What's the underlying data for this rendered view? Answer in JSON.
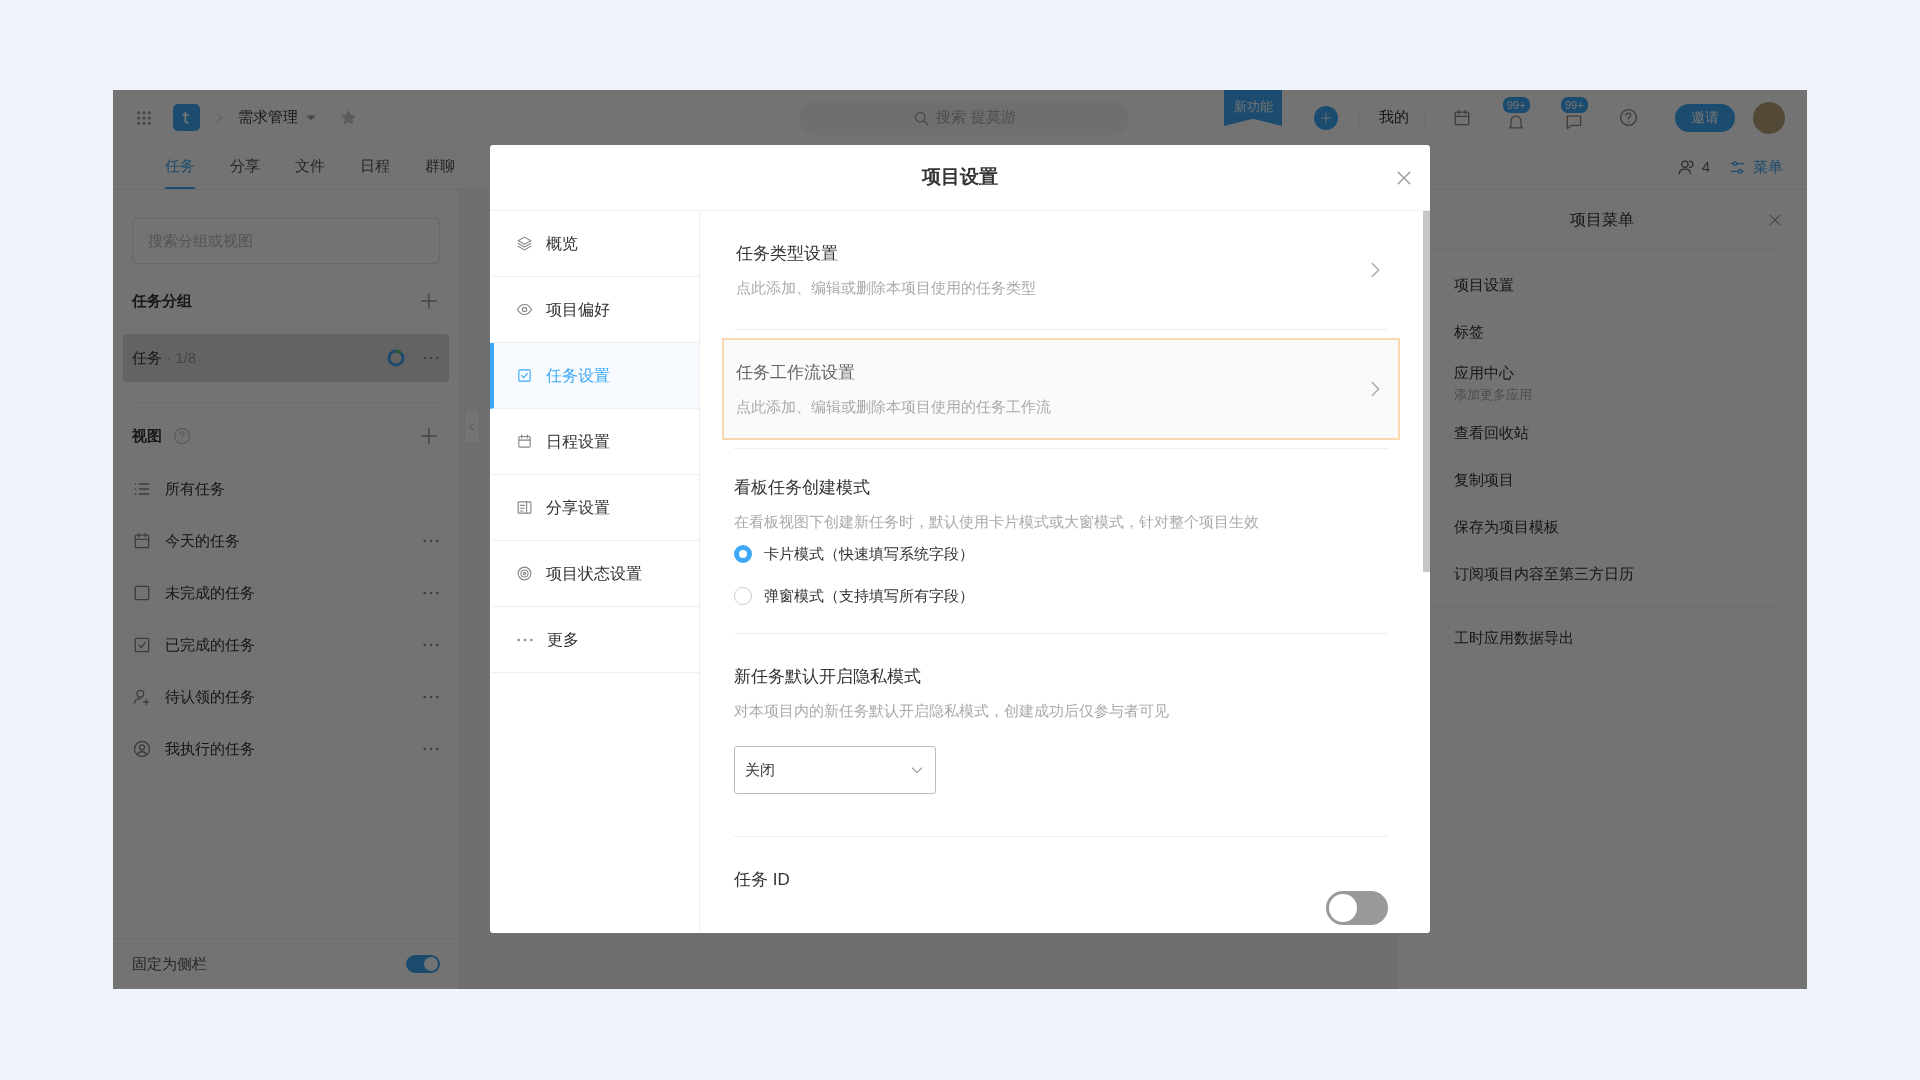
{
  "topbar": {
    "project": "需求管理",
    "search_placeholder": "搜索 提莫游",
    "new_feature_badge": "新功能",
    "mine": "我的",
    "badges": [
      {
        "count": "99+"
      },
      {
        "count": "99+"
      }
    ],
    "invite_button": "邀请"
  },
  "tabs": [
    {
      "label": "任务",
      "selected": true
    },
    {
      "label": "分享",
      "selected": false
    },
    {
      "label": "文件",
      "selected": false
    },
    {
      "label": "日程",
      "selected": false
    },
    {
      "label": "群聊",
      "selected": false
    }
  ],
  "members_count": "4",
  "menu_button": "菜单",
  "sidebar": {
    "search_placeholder": "搜索分组或视图",
    "groups_title": "任务分组",
    "groups": [
      {
        "label": "任务",
        "count": "· 1/8",
        "selected": true
      }
    ],
    "views_title": "视图",
    "views": [
      {
        "label": "所有任务",
        "more": false
      },
      {
        "label": "今天的任务",
        "more": true
      },
      {
        "label": "未完成的任务",
        "more": true
      },
      {
        "label": "已完成的任务",
        "more": true
      },
      {
        "label": "待认领的任务",
        "more": true
      },
      {
        "label": "我执行的任务",
        "more": true
      }
    ],
    "pin_label": "固定为侧栏",
    "pin_on": true
  },
  "project_menu": {
    "title": "项目菜单",
    "groups": [
      {
        "items": [
          {
            "label": "项目设置"
          },
          {
            "label": "标签"
          },
          {
            "label": "应用中心",
            "sub": "添加更多应用"
          },
          {
            "label": "查看回收站"
          },
          {
            "label": "复制项目"
          },
          {
            "label": "保存为项目模板"
          },
          {
            "label": "订阅项目内容至第三方日历"
          }
        ]
      },
      {
        "items": [
          {
            "label": "工时应用数据导出"
          }
        ]
      }
    ]
  },
  "dialog": {
    "title": "项目设置",
    "nav": [
      {
        "label": "概览",
        "selected": false
      },
      {
        "label": "项目偏好",
        "selected": false
      },
      {
        "label": "任务设置",
        "selected": true
      },
      {
        "label": "日程设置",
        "selected": false
      },
      {
        "label": "分享设置",
        "selected": false
      },
      {
        "label": "项目状态设置",
        "selected": false
      },
      {
        "label": "更多",
        "selected": false
      }
    ],
    "sections": [
      {
        "kind": "link",
        "title": "任务类型设置",
        "description": "点此添加、编辑或删除本项目使用的任务类型",
        "highlighted": false
      },
      {
        "kind": "link",
        "title": "任务工作流设置",
        "description": "点此添加、编辑或删除本项目使用的任务工作流",
        "highlighted": true
      },
      {
        "kind": "radio_group",
        "title": "看板任务创建模式",
        "description": "在看板视图下创建新任务时，默认使用卡片模式或大窗模式，针对整个项目生效",
        "options": [
          {
            "label": "卡片模式（快速填写系统字段）",
            "selected": true
          },
          {
            "label": "弹窗模式（支持填写所有字段）",
            "selected": false
          }
        ]
      },
      {
        "kind": "select",
        "title": "新任务默认开启隐私模式",
        "description": "对本项目内的新任务默认开启隐私模式，创建成功后仅参与者可见",
        "value": "关闭"
      },
      {
        "kind": "toggle",
        "title": "任务 ID",
        "on": false
      }
    ]
  }
}
